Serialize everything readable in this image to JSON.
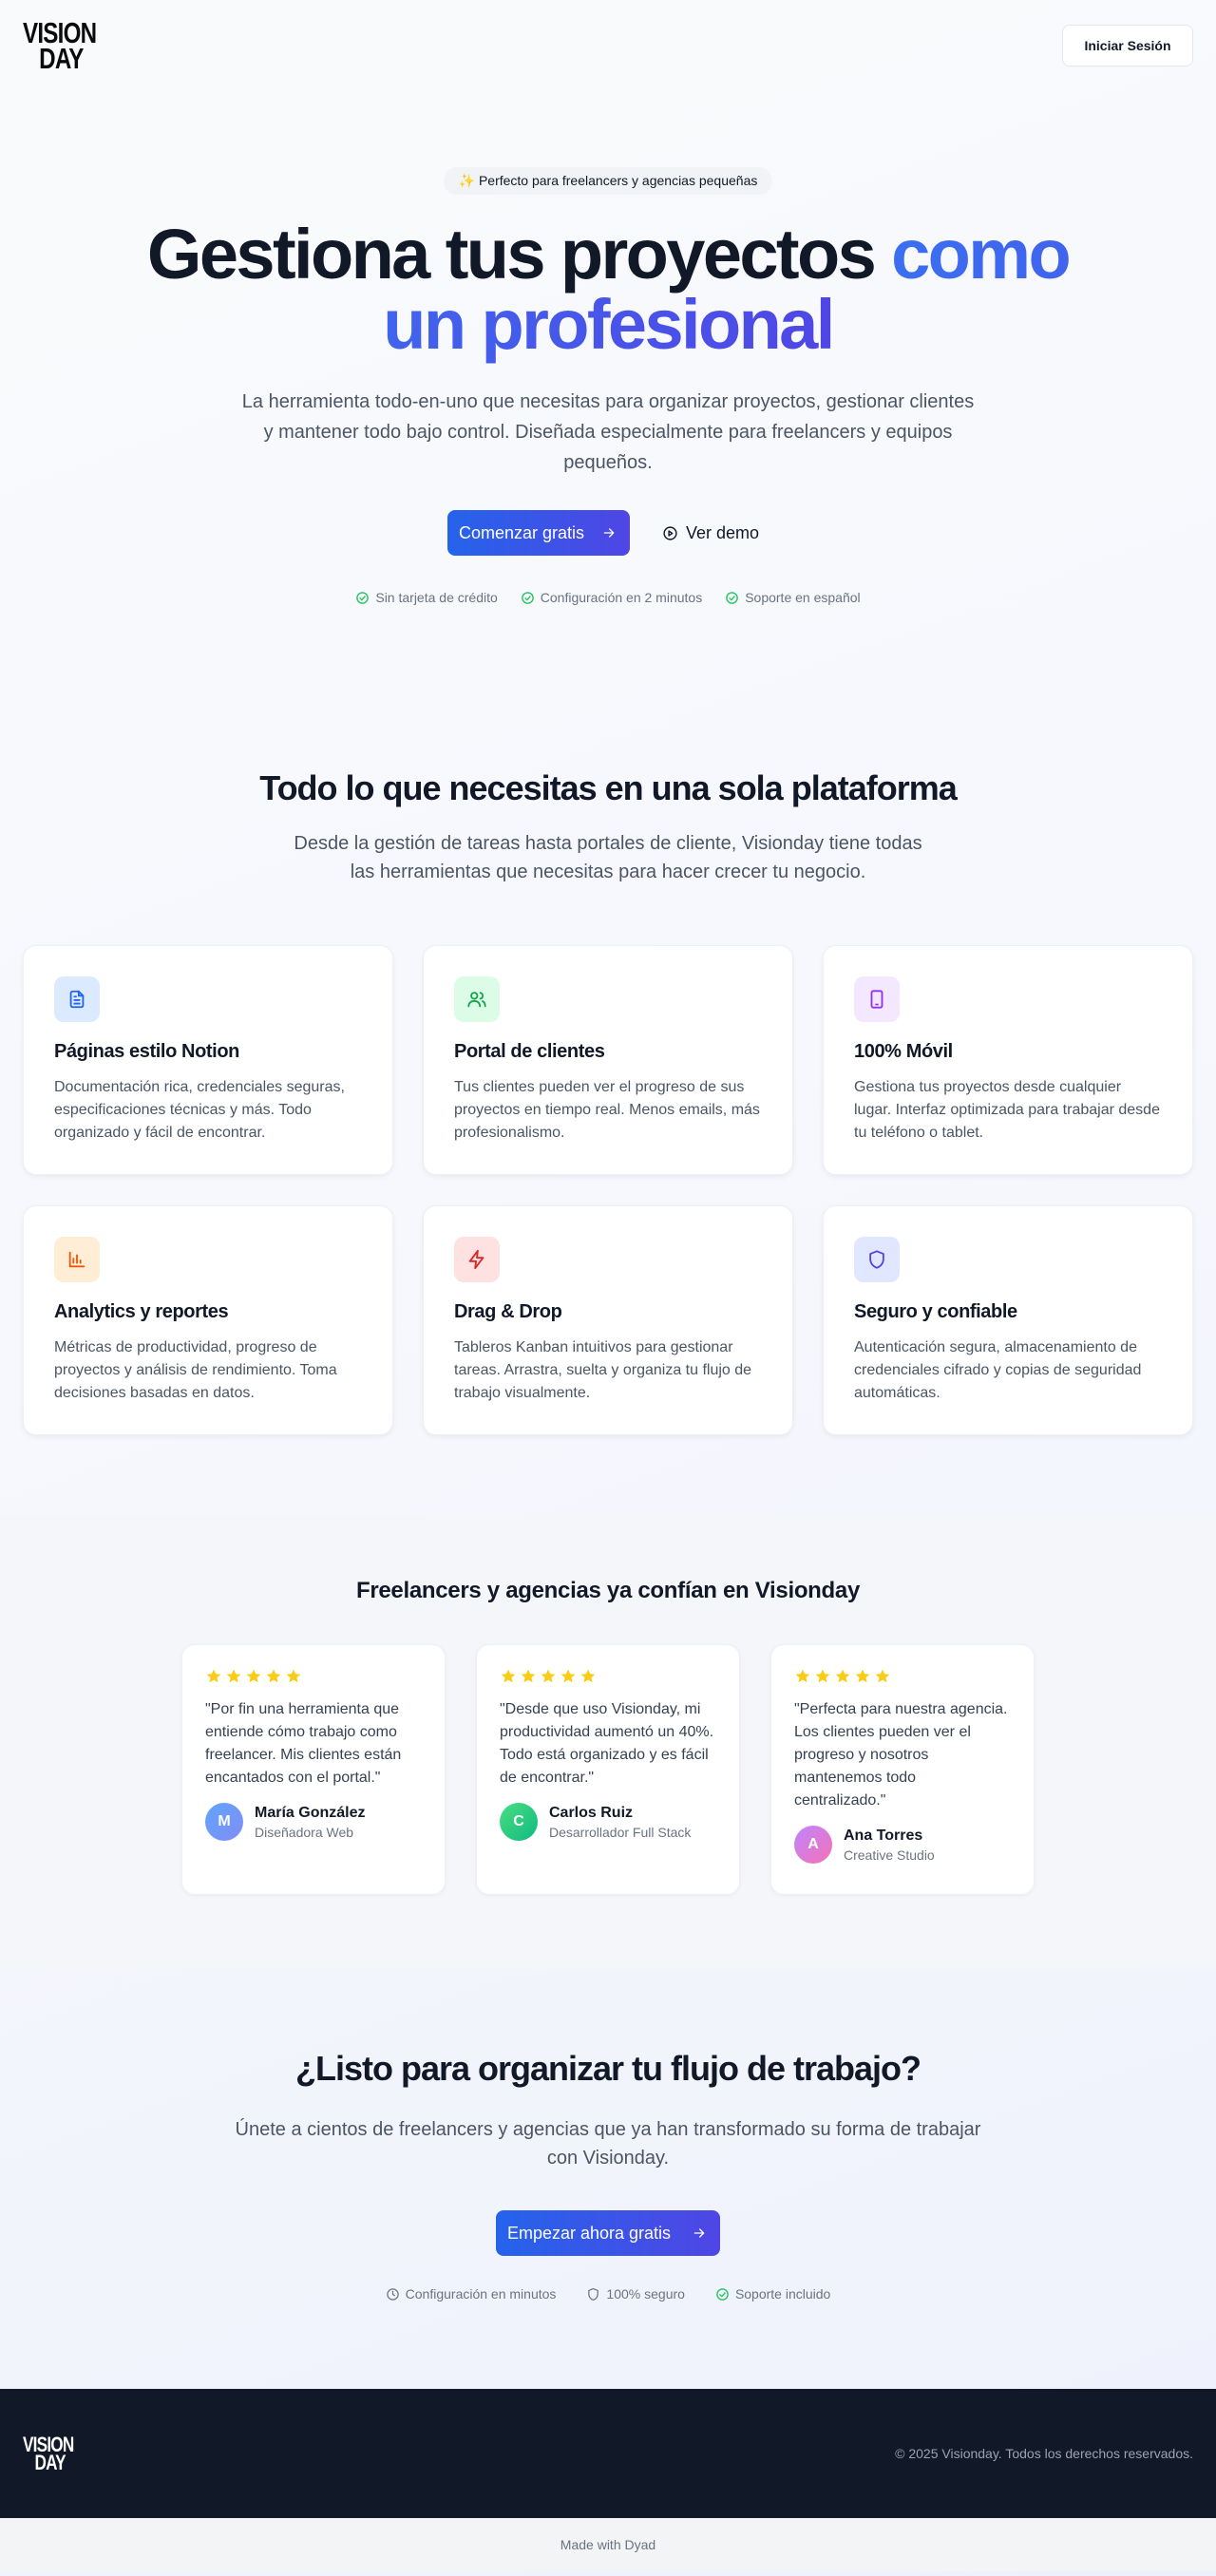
{
  "header": {
    "logo_line1": "VISION",
    "logo_line2": "DAY",
    "login_label": "Iniciar Sesión"
  },
  "hero": {
    "badge": "✨ Perfecto para freelancers y agencias pequeñas",
    "title_part1": "Gestiona tus proyectos",
    "title_part2": "como un profesional",
    "subtitle": "La herramienta todo-en-uno que necesitas para organizar proyectos, gestionar clientes y mantener todo bajo control. Diseñada especialmente para freelancers y equipos pequeños.",
    "primary_cta": "Comenzar gratis",
    "secondary_cta": "Ver demo",
    "checks": [
      "Sin tarjeta de crédito",
      "Configuración en 2 minutos",
      "Soporte en español"
    ]
  },
  "features": {
    "title": "Todo lo que necesitas en una sola plataforma",
    "subtitle": "Desde la gestión de tareas hasta portales de cliente, Visionday tiene todas las herramientas que necesitas para hacer crecer tu negocio.",
    "items": [
      {
        "title": "Páginas estilo Notion",
        "description": "Documentación rica, credenciales seguras, especificaciones técnicas y más. Todo organizado y fácil de encontrar.",
        "icon": "document-icon",
        "bg": "#dbeafe",
        "color": "#2563eb"
      },
      {
        "title": "Portal de clientes",
        "description": "Tus clientes pueden ver el progreso de sus proyectos en tiempo real. Menos emails, más profesionalismo.",
        "icon": "users-icon",
        "bg": "#dcfce7",
        "color": "#16a34a"
      },
      {
        "title": "100% Móvil",
        "description": "Gestiona tus proyectos desde cualquier lugar. Interfaz optimizada para trabajar desde tu teléfono o tablet.",
        "icon": "smartphone-icon",
        "bg": "#f3e8ff",
        "color": "#9333ea"
      },
      {
        "title": "Analytics y reportes",
        "description": "Métricas de productividad, progreso de proyectos y análisis de rendimiento. Toma decisiones basadas en datos.",
        "icon": "bar-chart-icon",
        "bg": "#ffedd5",
        "color": "#ea580c"
      },
      {
        "title": "Drag & Drop",
        "description": "Tableros Kanban intuitivos para gestionar tareas. Arrastra, suelta y organiza tu flujo de trabajo visualmente.",
        "icon": "lightning-icon",
        "bg": "#fee2e2",
        "color": "#dc2626"
      },
      {
        "title": "Seguro y confiable",
        "description": "Autenticación segura, almacenamiento de credenciales cifrado y copias de seguridad automáticas.",
        "icon": "shield-icon",
        "bg": "#e0e7ff",
        "color": "#4f46e5"
      }
    ]
  },
  "testimonials": {
    "title": "Freelancers y agencias ya confían en Visionday",
    "items": [
      {
        "rating": 5,
        "quote": "\"Por fin una herramienta que entiende cómo trabajo como freelancer. Mis clientes están encantados con el portal.\"",
        "name": "María González",
        "role": "Diseñadora Web",
        "initial": "M",
        "avatar_from": "#60a5fa",
        "avatar_to": "#818cf8"
      },
      {
        "rating": 5,
        "quote": "\"Desde que uso Visionday, mi productividad aumentó un 40%. Todo está organizado y es fácil de encontrar.\"",
        "name": "Carlos Ruiz",
        "role": "Desarrollador Full Stack",
        "initial": "C",
        "avatar_from": "#4ade80",
        "avatar_to": "#10b981"
      },
      {
        "rating": 5,
        "quote": "\"Perfecta para nuestra agencia. Los clientes pueden ver el progreso y nosotros mantenemos todo centralizado.\"",
        "name": "Ana Torres",
        "role": "Creative Studio",
        "initial": "A",
        "avatar_from": "#c084fc",
        "avatar_to": "#f472b6"
      }
    ]
  },
  "cta": {
    "title": "¿Listo para organizar tu flujo de trabajo?",
    "subtitle": "Únete a cientos de freelancers y agencias que ya han transformado su forma de trabajar con Visionday.",
    "button": "Empezar ahora gratis",
    "checks": [
      {
        "label": "Configuración en minutos",
        "icon": "clock-icon"
      },
      {
        "label": "100% seguro",
        "icon": "shield-icon"
      },
      {
        "label": "Soporte incluido",
        "icon": "check-circle-icon"
      }
    ]
  },
  "footer": {
    "copyright": "© 2025 Visionday. Todos los derechos reservados.",
    "made_with": "Made with Dyad"
  },
  "colors": {
    "primary": "#2563eb",
    "primary_end": "#4f46e5",
    "check": "#22c55e",
    "star": "#facc15",
    "footer_bg": "#111827"
  }
}
